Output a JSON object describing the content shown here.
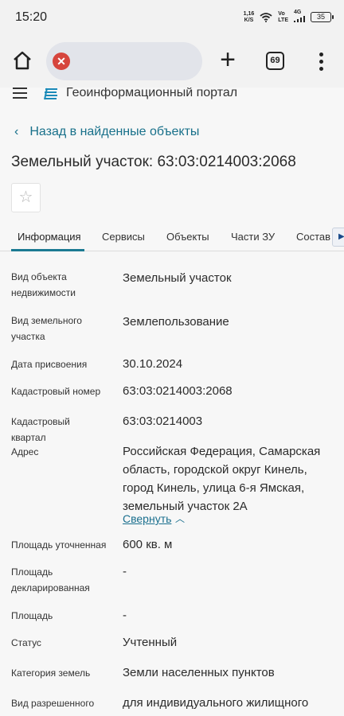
{
  "status_bar": {
    "time": "15:20",
    "speed_value": "1,16",
    "speed_unit": "K/S",
    "net_top": "Vo",
    "net_bottom": "LTE",
    "net_gen": "4G",
    "battery": "35"
  },
  "browser": {
    "tab_count": "69",
    "icons": [
      "home-icon",
      "stop-icon",
      "plus-icon",
      "tabs-icon",
      "menu-icon"
    ]
  },
  "site": {
    "portal_title": "Геоинформационный портал"
  },
  "page": {
    "back_link": "Назад в найденные объекты",
    "title": "Земельный участок: 63:03:0214003:2068",
    "favorite_icon": "☆"
  },
  "tabs": [
    {
      "label": "Информация"
    },
    {
      "label": "Сервисы"
    },
    {
      "label": "Объекты"
    },
    {
      "label": "Части ЗУ"
    },
    {
      "label": "Состав"
    }
  ],
  "properties": [
    {
      "label": "Вид объекта недвижимости",
      "value": "Земельный участок"
    },
    {
      "label": "Вид земельного участка",
      "value": "Землепользование"
    },
    {
      "label": "Дата присвоения",
      "value": "30.10.2024"
    },
    {
      "label": "Кадастровый номер",
      "value": "63:03:0214003:2068"
    },
    {
      "label": "Кадастровый квартал",
      "value": "63:03:0214003"
    },
    {
      "label": "Адрес",
      "value": "Российская Федерация, Самарская область, городской округ Кинель, город Кинель, улица 6-я Ямская, земельный участок 2А",
      "toggle": "Свернуть"
    },
    {
      "label": "Площадь уточненная",
      "value": "600 кв. м"
    },
    {
      "label": "Площадь декларированная",
      "value": "-"
    },
    {
      "label": "Площадь",
      "value": "-"
    },
    {
      "label": "Статус",
      "value": "Учтенный"
    },
    {
      "label": "Категория земель",
      "value": "Земли населенных пунктов"
    },
    {
      "label": "Вид разрешенного",
      "value": "для индивидуального жилищного"
    }
  ]
}
